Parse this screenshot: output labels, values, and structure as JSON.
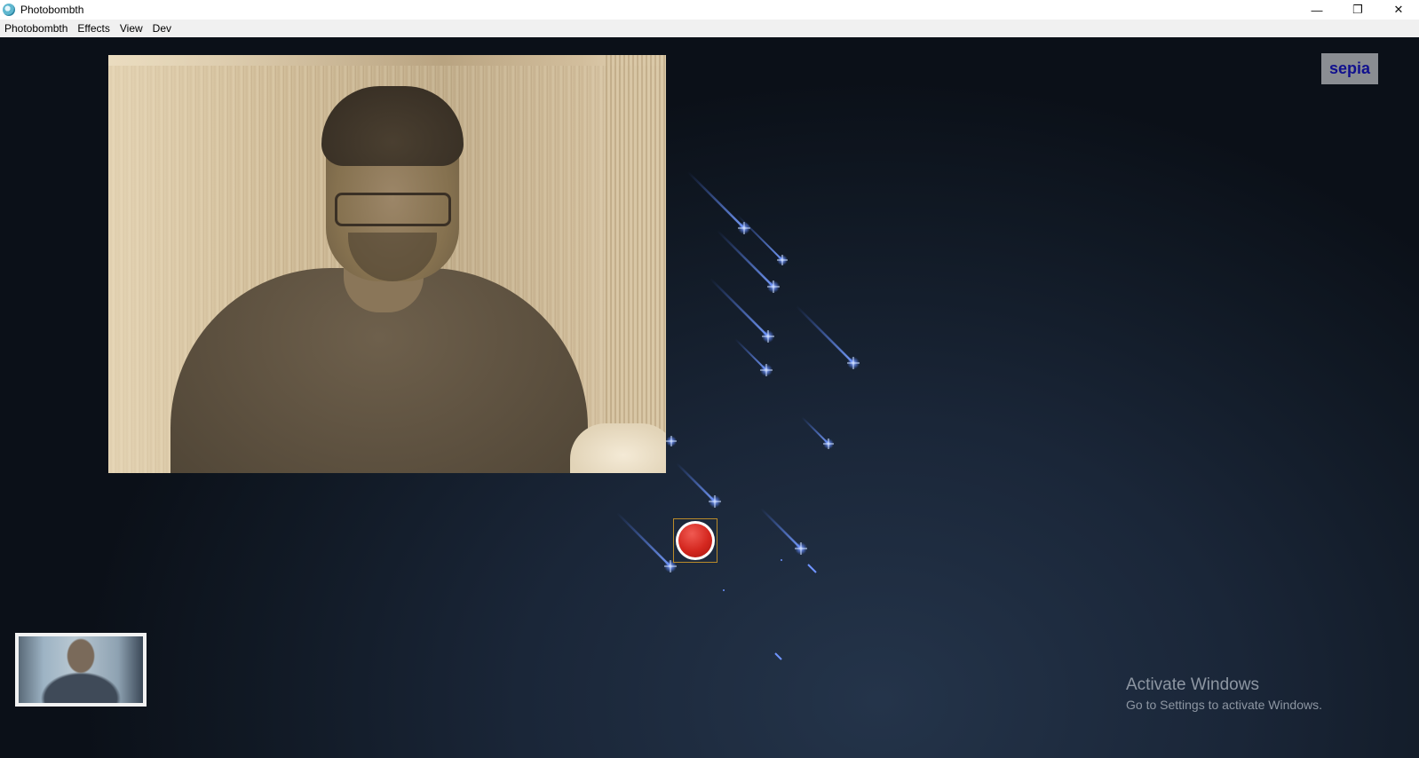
{
  "window": {
    "title": "Photobombth",
    "controls": {
      "minimize": "—",
      "maximize": "❐",
      "close": "✕"
    }
  },
  "menubar": {
    "items": [
      "Photobombth",
      "Effects",
      "View",
      "Dev"
    ]
  },
  "main": {
    "filter_label": "sepia",
    "record_button_color": "#d4271f",
    "webcam_filter": "sepia",
    "thumbnail_count": 1
  },
  "watermark": {
    "line1": "Activate Windows",
    "line2": "Go to Settings to activate Windows."
  },
  "colors": {
    "background_dark": "#0b1018",
    "background_mid": "#24344a",
    "star_color": "#4f7dff",
    "filter_button_bg": "#8a8d92",
    "filter_button_text": "#10108e"
  }
}
